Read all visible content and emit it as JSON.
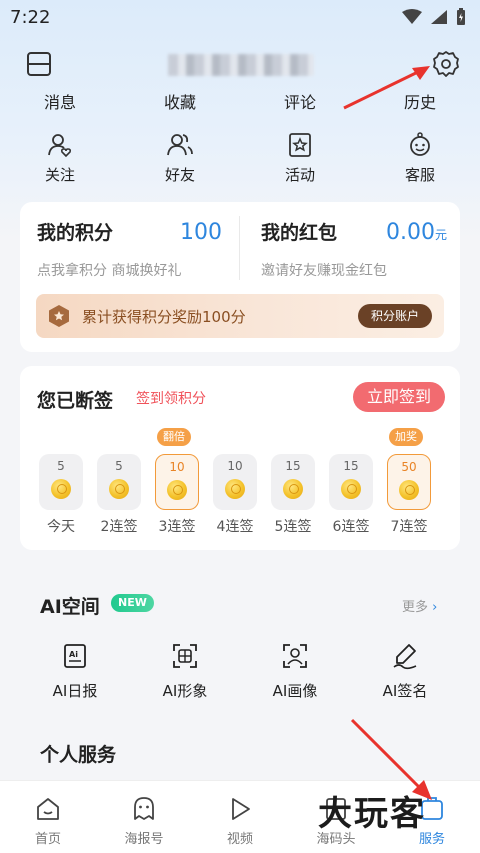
{
  "status": {
    "time": "7:22"
  },
  "header": {
    "username_masked": ""
  },
  "quick_links": [
    {
      "label": "消息"
    },
    {
      "label": "收藏"
    },
    {
      "label": "评论"
    },
    {
      "label": "历史"
    }
  ],
  "icon_links": [
    {
      "label": "关注",
      "icon": "person-heart-icon"
    },
    {
      "label": "好友",
      "icon": "friends-icon"
    },
    {
      "label": "活动",
      "icon": "star-bookmark-icon"
    },
    {
      "label": "客服",
      "icon": "service-face-icon"
    }
  ],
  "points": {
    "title": "我的积分",
    "value": "100",
    "sub": "点我拿积分 商城换好礼"
  },
  "redpacket": {
    "title": "我的红包",
    "value": "0.00",
    "unit": "元",
    "sub": "邀请好友赚现金红包"
  },
  "promo": {
    "text": "累计获得积分奖励100分",
    "button": "积分账户"
  },
  "sign": {
    "title": "您已断签",
    "subtitle": "签到领积分",
    "button": "立即签到",
    "days": [
      {
        "points": "5",
        "label": "今天",
        "tag": ""
      },
      {
        "points": "5",
        "label": "2连签",
        "tag": ""
      },
      {
        "points": "10",
        "label": "3连签",
        "tag": "翻倍"
      },
      {
        "points": "10",
        "label": "4连签",
        "tag": ""
      },
      {
        "points": "15",
        "label": "5连签",
        "tag": ""
      },
      {
        "points": "15",
        "label": "6连签",
        "tag": ""
      },
      {
        "points": "50",
        "label": "7连签",
        "tag": "加奖"
      }
    ]
  },
  "ai_space": {
    "title": "AI空间",
    "badge": "NEW",
    "more": "更多",
    "items": [
      {
        "label": "AI日报",
        "icon": "ai-daily-icon"
      },
      {
        "label": "AI形象",
        "icon": "ai-avatar-icon"
      },
      {
        "label": "AI画像",
        "icon": "ai-portrait-icon"
      },
      {
        "label": "AI签名",
        "icon": "ai-signature-icon"
      }
    ]
  },
  "personal_service": {
    "title": "个人服务"
  },
  "tabbar": [
    {
      "label": "首页",
      "icon": "home-face-icon",
      "active": false
    },
    {
      "label": "海报号",
      "icon": "ghost-icon",
      "active": false
    },
    {
      "label": "视频",
      "icon": "play-icon",
      "active": false
    },
    {
      "label": "海码头",
      "icon": "dock-icon",
      "active": false
    },
    {
      "label": "服务",
      "icon": "service-icon",
      "active": true
    }
  ],
  "watermark": "大玩客",
  "colors": {
    "accent": "#2e86de",
    "sign_button": "#f26b70",
    "arrow": "#e8332d"
  }
}
